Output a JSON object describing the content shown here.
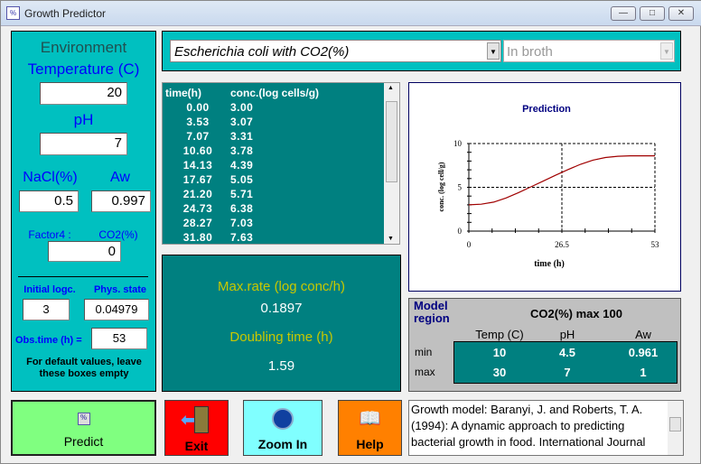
{
  "window": {
    "title": "Growth Predictor",
    "controls": [
      "minimize",
      "maximize",
      "close"
    ]
  },
  "environment": {
    "heading": "Environment",
    "temperature_label": "Temperature (C)",
    "temperature": "20",
    "ph_label": "pH",
    "ph": "7",
    "nacl_label": "NaCl(%)",
    "nacl": "0.5",
    "aw_label": "Aw",
    "aw": "0.997",
    "factor4_label": "Factor4 :",
    "factor4_name": "CO2(%)",
    "factor4": "0",
    "initial_label": "Initial logc.",
    "initial": "3",
    "phys_label": "Phys. state",
    "phys": "0.04979",
    "obs_label": "Obs.time (h) =",
    "obs": "53",
    "note": "For default values, leave these boxes empty"
  },
  "selectors": {
    "organism": "Escherichia coli with CO2(%)",
    "medium": "In broth"
  },
  "results_table": {
    "headers": [
      "time(h)",
      "conc.(log cells/g)"
    ],
    "rows": [
      [
        "0.00",
        "3.00"
      ],
      [
        "3.53",
        "3.07"
      ],
      [
        "7.07",
        "3.31"
      ],
      [
        "10.60",
        "3.78"
      ],
      [
        "14.13",
        "4.39"
      ],
      [
        "17.67",
        "5.05"
      ],
      [
        "21.20",
        "5.71"
      ],
      [
        "24.73",
        "6.38"
      ],
      [
        "28.27",
        "7.03"
      ],
      [
        "31.80",
        "7.63"
      ]
    ]
  },
  "rates": {
    "max_rate_label": "Max.rate (log conc/h)",
    "max_rate": "0.1897",
    "doubling_label": "Doubling time (h)",
    "doubling": "1.59"
  },
  "chart_data": {
    "type": "line",
    "title": "Prediction",
    "xlabel": "time (h)",
    "ylabel": "conc. (log cell/g)",
    "xlim": [
      0,
      53
    ],
    "ylim": [
      0,
      10
    ],
    "xticks": [
      "0",
      "26.5",
      "53"
    ],
    "yticks": [
      "0",
      "5",
      "10"
    ],
    "grid": "dashed",
    "series": [
      {
        "color": "#a00000",
        "x": [
          0,
          3.53,
          7.07,
          10.6,
          14.13,
          17.67,
          21.2,
          24.73,
          28.27,
          31.8,
          35.33,
          38.87,
          42.4,
          45.93,
          49.47,
          53
        ],
        "y": [
          3.0,
          3.07,
          3.31,
          3.78,
          4.39,
          5.05,
          5.71,
          6.38,
          7.03,
          7.63,
          8.1,
          8.4,
          8.55,
          8.6,
          8.6,
          8.6
        ]
      }
    ]
  },
  "model_region": {
    "title": "Model region",
    "factor_range": "CO2(%) max 100",
    "columns": [
      "Temp (C)",
      "pH",
      "Aw"
    ],
    "rows": [
      {
        "label": "min",
        "values": [
          "10",
          "4.5",
          "0.961"
        ]
      },
      {
        "label": "max",
        "values": [
          "30",
          "7",
          "1"
        ]
      }
    ]
  },
  "buttons": {
    "predict": "Predict",
    "exit": "Exit",
    "zoom": "Zoom In",
    "help": "Help"
  },
  "reference": "Growth model:  Baranyi, J. and Roberts, T. A. (1994):  A dynamic approach to predicting bacterial growth in food.   International Journal",
  "colors": {
    "panel": "#00c0c0",
    "dark": "#008080",
    "predict": "#80ff80",
    "exit": "#ff0000",
    "zoom": "#80ffff",
    "help": "#ff8000",
    "curve": "#a00000"
  }
}
